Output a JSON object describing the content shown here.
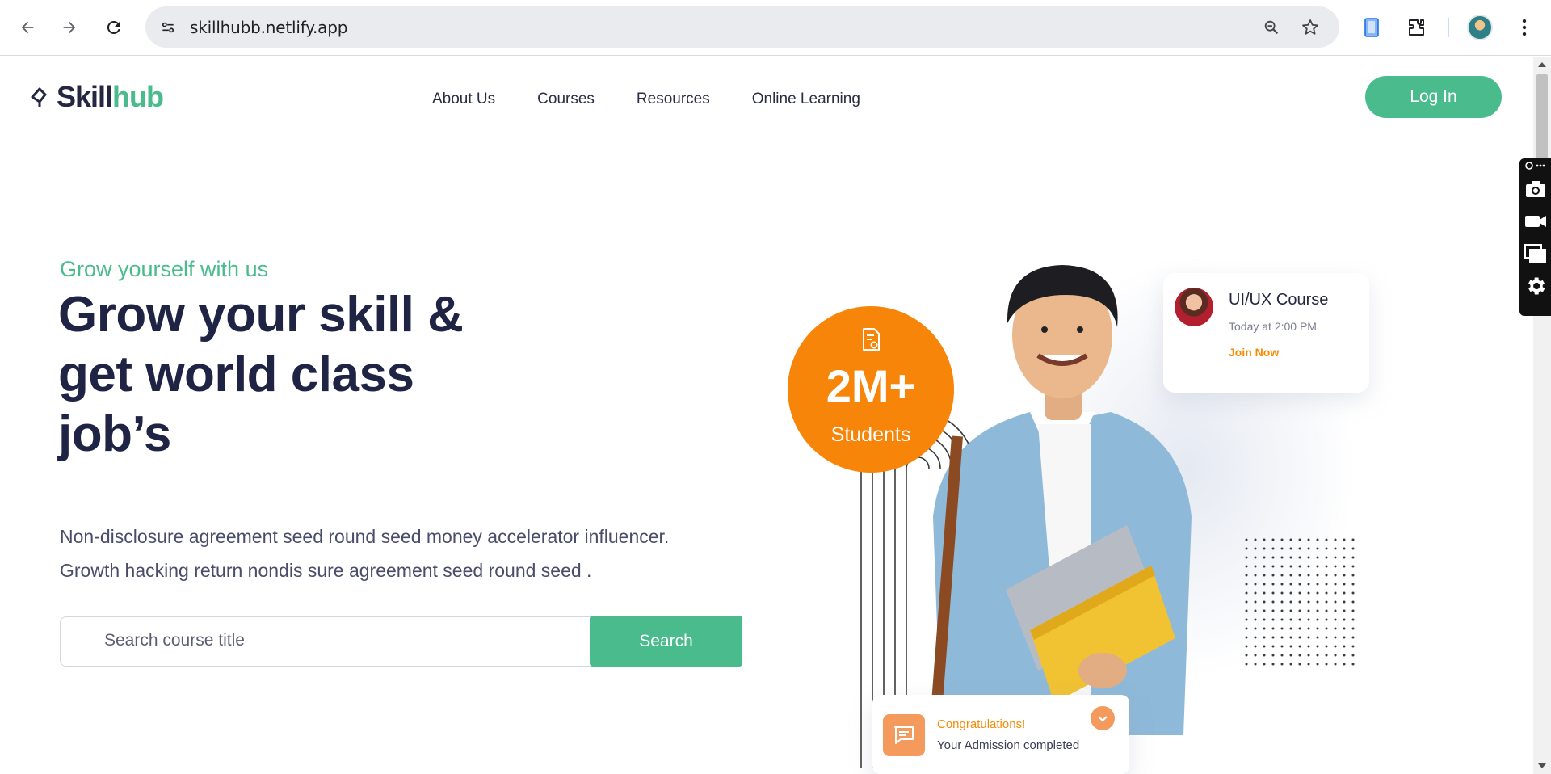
{
  "browser": {
    "url": "skillhubb.netlify.app",
    "icons": [
      "back-icon",
      "forward-icon",
      "reload-icon",
      "site-info-icon",
      "zoom-icon",
      "bookmark-star-icon",
      "mobile-icon",
      "extensions-icon",
      "profile-avatar",
      "more-menu-icon"
    ]
  },
  "site": {
    "logo_part1": "Skill",
    "logo_part2": "hub",
    "nav": [
      "About Us",
      "Courses",
      "Resources",
      "Online Learning"
    ],
    "login_label": "Log In"
  },
  "hero": {
    "eyebrow": "Grow yourself with us",
    "headline": "Grow your skill & get world class job’s",
    "description_line1": "Non-disclosure agreement seed round seed money accelerator influencer.",
    "description_line2": "Growth hacking return nondis sure agreement seed round seed .",
    "search_placeholder": "Search course title",
    "search_button": "Search"
  },
  "stat": {
    "value": "2M+",
    "label": "Students"
  },
  "course_card": {
    "title": "UI/UX Course",
    "time": "Today at 2:00 PM",
    "action": "Join Now"
  },
  "congrats_card": {
    "title": "Congratulations!",
    "subtitle": "Your Admission completed"
  },
  "colors": {
    "brand_green": "#49bb8c",
    "orange": "#f7850a",
    "navy": "#1f2344"
  }
}
